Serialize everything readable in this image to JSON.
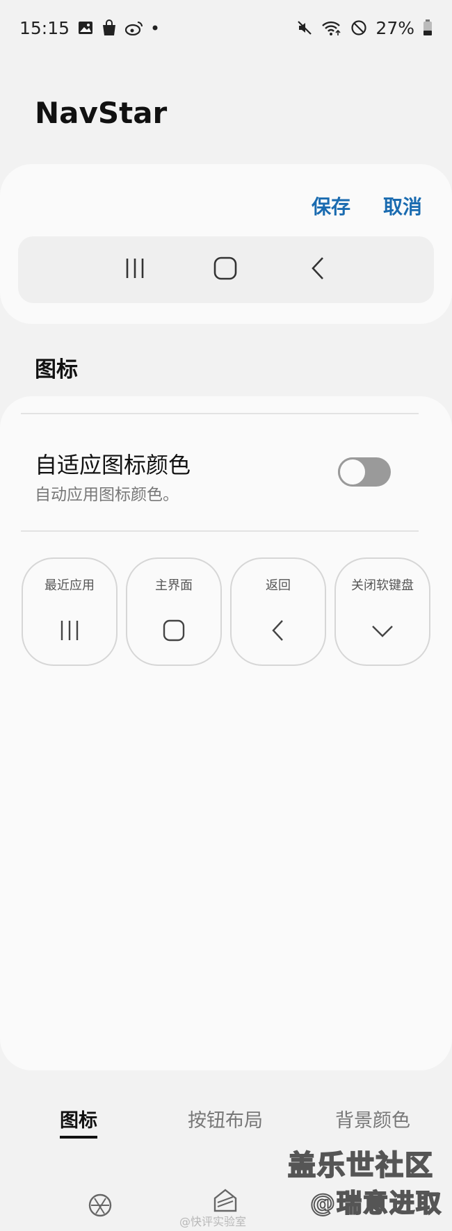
{
  "status_bar": {
    "time": "15:15",
    "battery": "27%",
    "left_icons": [
      "image-icon",
      "shopping-bag-icon",
      "weibo-icon",
      "dot-icon"
    ],
    "right_icons": [
      "mute-icon",
      "wifi-icon",
      "no-disturb-icon",
      "battery-icon"
    ]
  },
  "app": {
    "title": "NavStar"
  },
  "preview": {
    "save_label": "保存",
    "cancel_label": "取消",
    "icons": [
      "recents-icon",
      "home-icon",
      "back-icon"
    ]
  },
  "section": {
    "title": "图标"
  },
  "setting": {
    "title": "自适应图标颜色",
    "subtitle": "自动应用图标颜色。",
    "toggle_on": false
  },
  "keys": [
    {
      "label": "最近应用",
      "icon": "recents-icon"
    },
    {
      "label": "主界面",
      "icon": "home-icon"
    },
    {
      "label": "返回",
      "icon": "back-icon"
    },
    {
      "label": "关闭软键盘",
      "icon": "chevron-down-icon"
    }
  ],
  "tabs": [
    {
      "label": "图标",
      "active": true
    },
    {
      "label": "按钮布局",
      "active": false
    },
    {
      "label": "背景颜色",
      "active": false
    }
  ],
  "watermarks": {
    "weibo": "@快评实验室",
    "brand_line1": "盖乐世社区",
    "brand_line2": "@瑞意进取"
  },
  "colors": {
    "accent": "#1a6bb0",
    "toggle_off": "#9a9a9a"
  }
}
